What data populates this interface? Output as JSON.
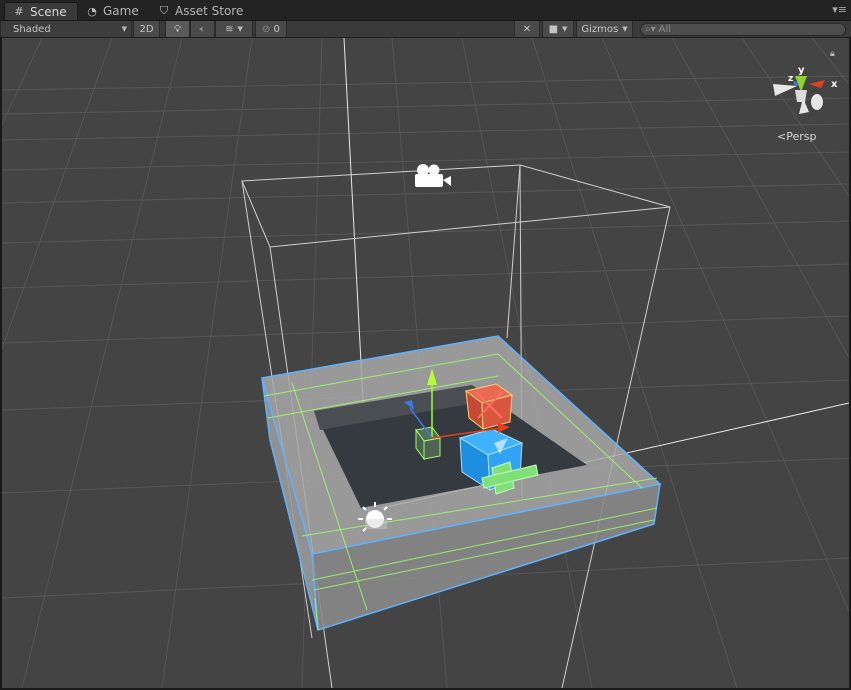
{
  "tabs": [
    {
      "label": "Scene",
      "icon": "scene-grid-icon"
    },
    {
      "label": "Game",
      "icon": "game-pacman-icon"
    },
    {
      "label": "Asset Store",
      "icon": "asset-store-bag-icon"
    }
  ],
  "toolbar": {
    "shading_mode": "Shaded",
    "mode_2d": "2D",
    "hidden_count": "0",
    "gizmos_label": "Gizmos",
    "search_placeholder": "All"
  },
  "scene": {
    "projection_label": "Persp",
    "axis_labels": {
      "x": "x",
      "y": "y",
      "z": "z"
    }
  },
  "colors": {
    "scene_bg": "#444444",
    "selection_outline": "#5fb2ff",
    "wire_green": "#9dff6a",
    "axis_x": "#e0401e",
    "axis_y": "#8ed22a",
    "axis_z": "#3d78e8"
  }
}
